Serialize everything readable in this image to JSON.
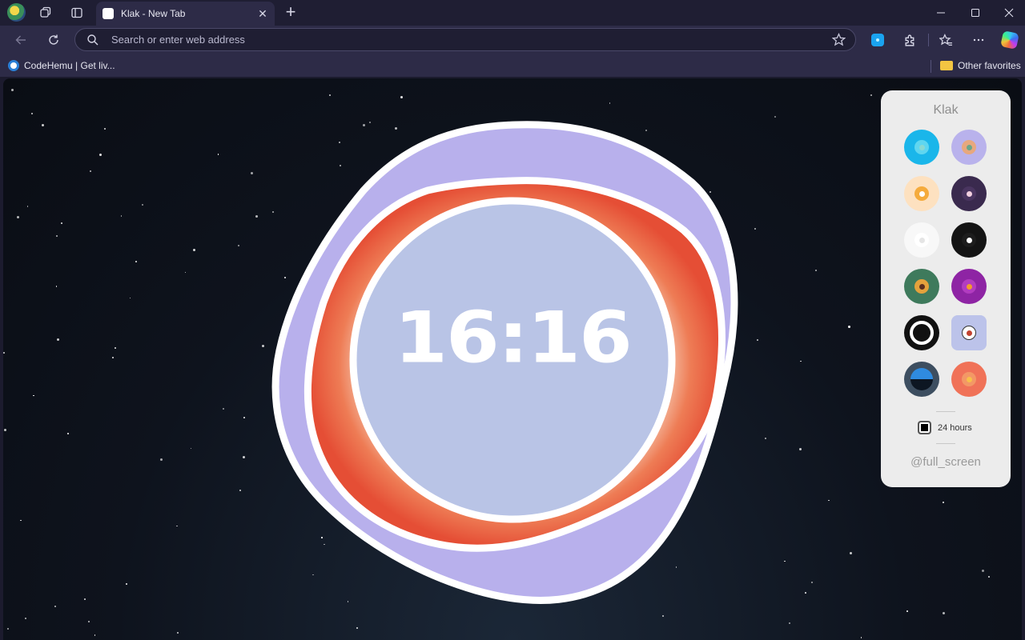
{
  "browser": {
    "tab_title": "Klak - New Tab",
    "address_placeholder": "Search or enter web address",
    "bookmarks": [
      {
        "label": "CodeHemu | Get liv..."
      }
    ],
    "other_favorites_label": "Other favorites"
  },
  "clock": {
    "time": "16:16",
    "colors": {
      "outer_blob": "#b8b0ec",
      "ring": "#ee5a3c",
      "face": "#b9c4e6",
      "stroke": "#ffffff"
    }
  },
  "panel": {
    "title": "Klak",
    "themes": [
      {
        "name": "theme-cyan",
        "bg": "#1ab6ea",
        "inner": "#5fd6f0",
        "dot": "#8ad9d3"
      },
      {
        "name": "theme-lavender",
        "bg": "#b9b2ec",
        "inner": "#e7a87e",
        "dot": "#6aa68a"
      },
      {
        "name": "theme-peach",
        "bg": "#fde1c0",
        "inner": "#f5ab3c",
        "dot": "#ffffff"
      },
      {
        "name": "theme-plum",
        "bg": "#3a2a4e",
        "inner": "#4a3560",
        "dot": "#f2d0e0"
      },
      {
        "name": "theme-white",
        "bg": "#f8f8f8",
        "inner": "#ffffff",
        "dot": "#e5e5e5"
      },
      {
        "name": "theme-black",
        "bg": "#141414",
        "inner": "#1d1d1d",
        "dot": "#ffffff"
      },
      {
        "name": "theme-green",
        "bg": "#3e7a5c",
        "inner": "#e4a23c",
        "dot": "#5a2f20"
      },
      {
        "name": "theme-purple",
        "bg": "#8e24a4",
        "inner": "#b23cc0",
        "dot": "#f39b2c"
      },
      {
        "name": "theme-bullseye",
        "bg": "#111111",
        "inner": "#ffffff",
        "dot": "#111111"
      },
      {
        "name": "theme-periwinkle",
        "bg": "#bcc3ea",
        "inner": "#ffffff",
        "dot": "#c24330"
      },
      {
        "name": "theme-slate",
        "bg": "#3d4e60",
        "inner": "#2f8be0",
        "dot": "#0d1622"
      },
      {
        "name": "theme-coral",
        "bg": "#f07258",
        "inner": "#f39866",
        "dot": "#f8c04a"
      }
    ],
    "hour_format_label": "24 hours",
    "hour_format_checked": true,
    "fullscreen_label": "@full_screen"
  }
}
